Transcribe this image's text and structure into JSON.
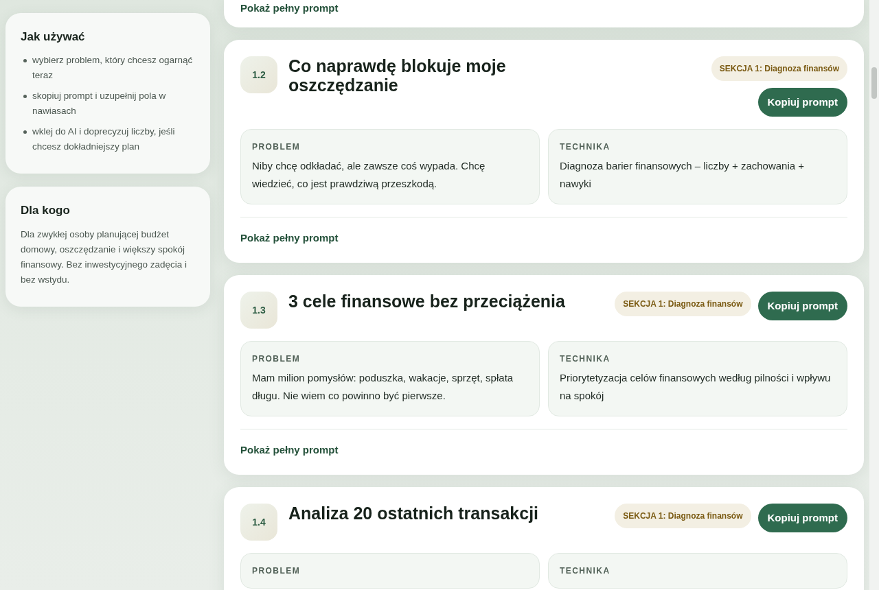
{
  "sidebar": [
    {
      "title": "Jak używać",
      "items": [
        "wybierz problem, który chcesz ogarnąć teraz",
        "skopiuj prompt i uzupełnij pola w nawiasach",
        "wklej do AI i doprecyzuj liczby, jeśli chcesz dokładniejszy plan"
      ]
    },
    {
      "title": "Dla kogo",
      "text": "Dla zwykłej osoby planującej budżet domowy, oszczędzanie i większy spokój finansowy. Bez inwestycyjnego zadęcia i bez wstydu."
    }
  ],
  "partial_card": {
    "link": "Pokaż pełny prompt"
  },
  "cards": [
    {
      "number": "1.2",
      "title": "Co naprawdę blokuje moje oszczędzanie",
      "section": "SEKCJA 1: Diagnoza finansów",
      "copy": "Kopiuj prompt",
      "boxes": [
        {
          "label": "PROBLEM",
          "text": "Niby chcę odkładać, ale zawsze coś wypada. Chcę wiedzieć, co jest prawdziwą przeszkodą."
        },
        {
          "label": "TECHNIKA",
          "text": "Diagnoza barier finansowych – liczby + zachowania + nawyki"
        }
      ],
      "link": "Pokaż pełny prompt"
    },
    {
      "number": "1.3",
      "title": "3 cele finansowe bez przeciążenia",
      "section": "SEKCJA 1: Diagnoza finansów",
      "copy": "Kopiuj prompt",
      "boxes": [
        {
          "label": "PROBLEM",
          "text": "Mam milion pomysłów: poduszka, wakacje, sprzęt, spłata długu. Nie wiem co powinno być pierwsze."
        },
        {
          "label": "TECHNIKA",
          "text": "Priorytetyzacja celów finansowych według pilności i wpływu na spokój"
        }
      ],
      "link": "Pokaż pełny prompt"
    },
    {
      "number": "1.4",
      "title": "Analiza 20 ostatnich transakcji",
      "section": "SEKCJA 1: Diagnoza finansów",
      "copy": "Kopiuj prompt",
      "boxes": [
        {
          "label": "PROBLEM"
        },
        {
          "label": "TECHNIKA"
        }
      ]
    }
  ]
}
